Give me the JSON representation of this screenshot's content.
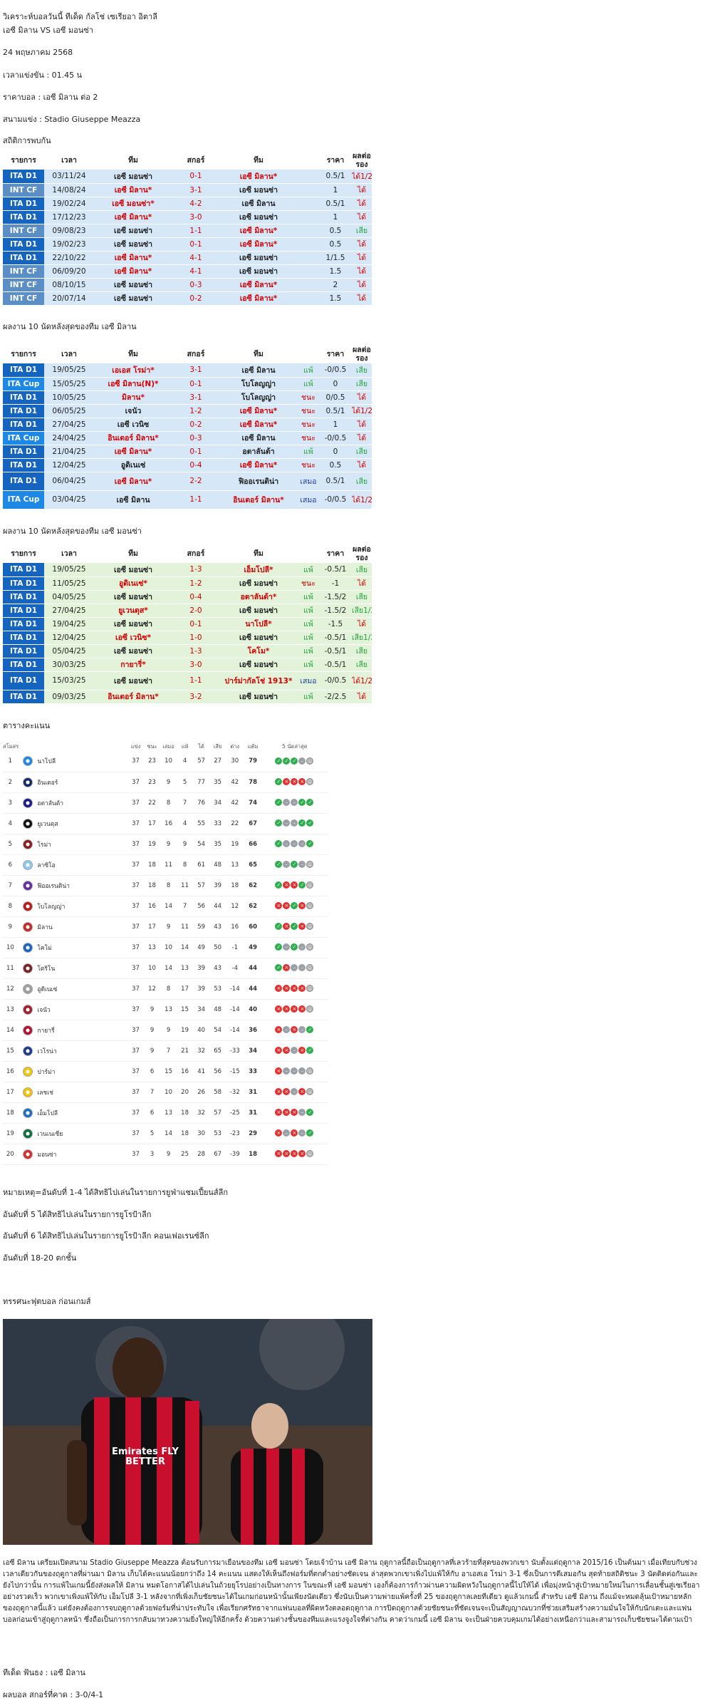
{
  "article": {
    "title": "วิเคราะห์บอลวันนี้ ทีเด็ด กัลโช่ เซเรียอา อิตาลี",
    "match": "เอซี มิลาน VS เอซี มอนซ่า",
    "date": "24 พฤษภาคม 2568",
    "kickoff": "เวลาแข่งขัน : 01.45 น",
    "price": "ราคาบอล : เอซี มิลาน ต่อ 2",
    "venue": "สนามแข่ง : Stadio Giuseppe Meazza",
    "h2h_heading": "สถิติการพบกัน",
    "milan_heading": "ผลงาน 10 นัดหลังสุดของทีม เอซี มิลาน",
    "monza_heading": "ผลงาน 10 นัดหลังสุดของทีม เอซี มอนซ่า",
    "standings_heading": "ตารางคะแนน",
    "notes": [
      "หมายเหตุ=อันดับที่ 1-4 ได้สิทธิไปเล่นในรายการยูฟ่าแชมเปี้ยนส์ลีก",
      "อันดับที่ 5 ได้สิทธิไปเล่นในรายการยูโรป้าลีก",
      "อันดับที่ 6 ได้สิทธิไปเล่นในรายการยูโรป้าลีก คอนเฟอเรนซ์ลีก",
      "อันดับที่ 18-20 ตกชั้น"
    ],
    "analysis_heading": "ทรรศนะฟุตบอล ก่อนเกมส์",
    "photo_alt": "ภาพนักเตะเอซี มิลาน",
    "photo_shirt_text": "Emirates FLY BETTER",
    "paragraph": "เอซี มิลาน เตรียมเปิดสนาม Stadio Giuseppe Meazza ต้อนรับการมาเยือนของทีม เอซี มอนซ่า โดยเจ้าบ้าน เอซี มิลาน ฤดูกาลนี้ถือเป็นฤดูกาลที่เลวร้ายที่สุดของพวกเขา นับตั้งแต่ฤดูกาล 2015/16 เป็นต้นมา เมื่อเทียบกับช่วงเวลาเดียวกันของฤดูกาลที่ผ่านมา มิลาน เก็บได้คะแนนน้อยกว่าถึง 14 คะแนน แสดงให้เห็นถึงฟอร์มที่ตกต่ำอย่างชัดเจน ล่าสุดพวกเขาเพิ่งไปแพ้ให้กับ อาเอสเอ โรม่า 3-1 ซึ่งเป็นการตีเสมอกัน สุดท้ายสถิติชนะ 3 นัดติดต่อกันและยังไปกว่านั้น การแพ้ในเกมนี้ยังส่งผลให้ มิลาน หมดโอกาสได้ไปเล่นในถ้วยยุโรปอย่างเป็นทางการ ในขณะที่ เอซี มอนซ่า เองก็ต้องการก้าวผ่านความผิดหวังในฤดูกาลนี้ไปให้ได้ เพื่อมุ่งหน้าสู่เป้าหมายใหม่ในการเลื่อนชั้นสู่เซเรียอาอย่างรวดเร็ว พวกเขาเพิ่งแพ้ให้กับ เอ็มโปลี 3-1 หลังจากที่เพิ่งเก็บชัยชนะได้ในเกมก่อนหน้านั้นเพียงนัดเดียว ซึ่งนับเป็นความพ่ายแพ้ครั้งที่ 25 ของฤดูกาลเลยทีเดียว ดูแล้วเกมนี้ สำหรับ เอซี มิลาน ถึงแม้จะหมดลุ้นเป้าหมายหลักของฤดูกาลนี้แล้ว แต่ยังคงต้องการจบฤดูกาลด้วยฟอร์มที่น่าประทับใจ เพื่อเรียกศรัทธาจากแฟนบอลที่ผิดหวังตลอดฤดูกาล การปิดฤดูกาลด้วยชัยชนะที่ชัดเจนจะเป็นสัญญาณบวกที่ช่วยเสริมสร้างความมั่นใจให้กับนักเตะและแฟนบอลก่อนเข้าสู่ฤดูกาลหน้า ซึ่งถือเป็นการการกลับมาทวงความยิ่งใหญ่ให้อีกครั้ง ด้วยความต่างชั้นของทีมและแรงจูงใจที่ต่างกัน คาดว่าเกมนี้ เอซี มิลาน จะเป็นฝ่ายควบคุมเกมได้อย่างเหนือกว่าและสามารถเก็บชัยชนะได้ตามเป้า",
    "pick": "ทีเด็ด ฟันธง : เอซี มิลาน",
    "score": "ผลบอล สกอร์ที่คาด : 3-0/4-1"
  },
  "form_headers": [
    "รายการ",
    "เวลา",
    "ทีม",
    "สกอร์",
    "ทีม",
    "",
    "ราคา",
    "ผลต่อรอง"
  ],
  "h2h_rows": [
    {
      "lg": "ITA D1",
      "date": "03/11/24",
      "home": "เอซี มอนซ่า",
      "score": "0-1",
      "away": "เอซี มิลาน*",
      "res": "",
      "price": "0.5/1",
      "ou": "ได้1/2"
    },
    {
      "lg": "INT CF",
      "date": "14/08/24",
      "home": "เอซี มิลาน*",
      "score": "3-1",
      "away": "เอซี มอนซ่า",
      "res": "",
      "price": "1",
      "ou": "ได้"
    },
    {
      "lg": "ITA D1",
      "date": "19/02/24",
      "home": "เอซี มอนซ่า*",
      "score": "4-2",
      "away": "เอซี มิลาน",
      "res": "",
      "price": "0.5/1",
      "ou": "ได้"
    },
    {
      "lg": "ITA D1",
      "date": "17/12/23",
      "home": "เอซี มิลาน*",
      "score": "3-0",
      "away": "เอซี มอนซ่า",
      "res": "",
      "price": "1",
      "ou": "ได้"
    },
    {
      "lg": "INT CF",
      "date": "09/08/23",
      "home": "เอซี มอนซ่า",
      "score": "1-1",
      "away": "เอซี มิลาน*",
      "res": "",
      "price": "0.5",
      "ou": "เสีย"
    },
    {
      "lg": "ITA D1",
      "date": "19/02/23",
      "home": "เอซี มอนซ่า",
      "score": "0-1",
      "away": "เอซี มิลาน*",
      "res": "",
      "price": "0.5",
      "ou": "ได้"
    },
    {
      "lg": "ITA D1",
      "date": "22/10/22",
      "home": "เอซี มิลาน*",
      "score": "4-1",
      "away": "เอซี มอนซ่า",
      "res": "",
      "price": "1/1.5",
      "ou": "ได้"
    },
    {
      "lg": "INT CF",
      "date": "06/09/20",
      "home": "เอซี มิลาน*",
      "score": "4-1",
      "away": "เอซี มอนซ่า",
      "res": "",
      "price": "1.5",
      "ou": "ได้"
    },
    {
      "lg": "INT CF",
      "date": "08/10/15",
      "home": "เอซี มอนซ่า",
      "score": "0-3",
      "away": "เอซี มิลาน*",
      "res": "",
      "price": "2",
      "ou": "ได้"
    },
    {
      "lg": "INT CF",
      "date": "20/07/14",
      "home": "เอซี มอนซ่า",
      "score": "0-2",
      "away": "เอซี มิลาน*",
      "res": "",
      "price": "1.5",
      "ou": "ได้"
    }
  ],
  "milan_rows": [
    {
      "lg": "ITA D1",
      "date": "19/05/25",
      "home": "เอเอส โรม่า*",
      "score": "3-1",
      "away": "เอซี มิลาน",
      "res": "แพ้",
      "price": "-0/0.5",
      "ou": "เสีย"
    },
    {
      "lg": "ITA Cup",
      "date": "15/05/25",
      "home": "เอซี มิลาน(N)*",
      "score": "0-1",
      "away": "โบโลญญ่า",
      "res": "แพ้",
      "price": "0",
      "ou": "เสีย"
    },
    {
      "lg": "ITA D1",
      "date": "10/05/25",
      "home": "มิลาน*",
      "score": "3-1",
      "away": "โบโลญญ่า",
      "res": "ชนะ",
      "price": "0/0.5",
      "ou": "ได้"
    },
    {
      "lg": "ITA D1",
      "date": "06/05/25",
      "home": "เจนัว",
      "score": "1-2",
      "away": "เอซี มิลาน*",
      "res": "ชนะ",
      "price": "0.5/1",
      "ou": "ได้1/2"
    },
    {
      "lg": "ITA D1",
      "date": "27/04/25",
      "home": "เอซี เวนิซ",
      "score": "0-2",
      "away": "เอซี มิลาน*",
      "res": "ชนะ",
      "price": "1",
      "ou": "ได้"
    },
    {
      "lg": "ITA Cup",
      "date": "24/04/25",
      "home": "อินเตอร์ มิลาน*",
      "score": "0-3",
      "away": "เอซี มิลาน",
      "res": "ชนะ",
      "price": "-0/0.5",
      "ou": "ได้"
    },
    {
      "lg": "ITA D1",
      "date": "21/04/25",
      "home": "เอซี มิลาน*",
      "score": "0-1",
      "away": "อตาลันต้า",
      "res": "แพ้",
      "price": "0",
      "ou": "เสีย"
    },
    {
      "lg": "ITA D1",
      "date": "12/04/25",
      "home": "อูดิเนเซ่",
      "score": "0-4",
      "away": "เอซี มิลาน*",
      "res": "ชนะ",
      "price": "0.5",
      "ou": "ได้"
    },
    {
      "lg": "ITA D1",
      "date": "06/04/25",
      "home": "เอซี มิลาน*",
      "score": "2-2",
      "away": "ฟิออเรนติน่า",
      "res": "เสมอ",
      "price": "0.5/1",
      "ou": "เสีย"
    },
    {
      "lg": "ITA Cup",
      "date": "03/04/25",
      "home": "เอซี มิลาน",
      "score": "1-1",
      "away": "อินเตอร์ มิลาน*",
      "res": "เสมอ",
      "price": "-0/0.5",
      "ou": "ได้1/2"
    }
  ],
  "monza_rows": [
    {
      "lg": "ITA D1",
      "date": "19/05/25",
      "home": "เอซี มอนซ่า",
      "score": "1-3",
      "away": "เอ็มโปลี*",
      "res": "แพ้",
      "price": "-0.5/1",
      "ou": "เสีย"
    },
    {
      "lg": "ITA D1",
      "date": "11/05/25",
      "home": "อูดิเนเซ่*",
      "score": "1-2",
      "away": "เอซี มอนซ่า",
      "res": "ชนะ",
      "price": "-1",
      "ou": "ได้"
    },
    {
      "lg": "ITA D1",
      "date": "04/05/25",
      "home": "เอซี มอนซ่า",
      "score": "0-4",
      "away": "อตาลันต้า*",
      "res": "แพ้",
      "price": "-1.5/2",
      "ou": "เสีย"
    },
    {
      "lg": "ITA D1",
      "date": "27/04/25",
      "home": "ยูเวนตุส*",
      "score": "2-0",
      "away": "เอซี มอนซ่า",
      "res": "แพ้",
      "price": "-1.5/2",
      "ou": "เสีย1/2"
    },
    {
      "lg": "ITA D1",
      "date": "19/04/25",
      "home": "เอซี มอนซ่า",
      "score": "0-1",
      "away": "นาโปลี*",
      "res": "แพ้",
      "price": "-1.5",
      "ou": "ได้"
    },
    {
      "lg": "ITA D1",
      "date": "12/04/25",
      "home": "เอซี เวนิซ*",
      "score": "1-0",
      "away": "เอซี มอนซ่า",
      "res": "แพ้",
      "price": "-0.5/1",
      "ou": "เสีย1/2"
    },
    {
      "lg": "ITA D1",
      "date": "05/04/25",
      "home": "เอซี มอนซ่า",
      "score": "1-3",
      "away": "โคโม*",
      "res": "แพ้",
      "price": "-0.5/1",
      "ou": "เสีย"
    },
    {
      "lg": "ITA D1",
      "date": "30/03/25",
      "home": "กายารี่*",
      "score": "3-0",
      "away": "เอซี มอนซ่า",
      "res": "แพ้",
      "price": "-0.5/1",
      "ou": "เสีย"
    },
    {
      "lg": "ITA D1",
      "date": "15/03/25",
      "home": "เอซี มอนซ่า",
      "score": "1-1",
      "away": "ปาร์ม่ากัลโช่ 1913*",
      "res": "เสมอ",
      "price": "-0/0.5",
      "ou": "ได้1/2"
    },
    {
      "lg": "ITA D1",
      "date": "09/03/25",
      "home": "อินเตอร์ มิลาน*",
      "score": "3-2",
      "away": "เอซี มอนซ่า",
      "res": "แพ้",
      "price": "-2/2.5",
      "ou": "ได้"
    }
  ],
  "standings": {
    "headers": [
      "สโมสร",
      "",
      "แข่ง",
      "ชนะ",
      "เสมอ",
      "แพ้",
      "ได้",
      "เสีย",
      "ต่าง",
      "แต้ม",
      "5 นัดล่าสุด"
    ],
    "rows": [
      {
        "pos": "1",
        "team": "นาโปลี",
        "logo": "#1e88e5",
        "p": "37",
        "w": "23",
        "d": "10",
        "l": "4",
        "gf": "57",
        "ga": "27",
        "gd": "30",
        "pts": "79",
        "form": [
          "W",
          "W",
          "W",
          "D",
          "N"
        ]
      },
      {
        "pos": "2",
        "team": "อินเตอร์",
        "logo": "#102a6b",
        "p": "37",
        "w": "23",
        "d": "9",
        "l": "5",
        "gf": "77",
        "ga": "35",
        "gd": "42",
        "pts": "78",
        "form": [
          "W",
          "L",
          "L",
          "L",
          "N"
        ]
      },
      {
        "pos": "3",
        "team": "อตาลันต้า",
        "logo": "#1a1a8a",
        "p": "37",
        "w": "22",
        "d": "8",
        "l": "7",
        "gf": "76",
        "ga": "34",
        "gd": "42",
        "pts": "74",
        "form": [
          "W",
          "D",
          "D",
          "W",
          "W"
        ]
      },
      {
        "pos": "4",
        "team": "ยูเวนตุส",
        "logo": "#111111",
        "p": "37",
        "w": "17",
        "d": "16",
        "l": "4",
        "gf": "55",
        "ga": "33",
        "gd": "22",
        "pts": "67",
        "form": [
          "W",
          "D",
          "D",
          "W",
          "W"
        ]
      },
      {
        "pos": "5",
        "team": "โรม่า",
        "logo": "#8e1b1b",
        "p": "37",
        "w": "19",
        "d": "9",
        "l": "9",
        "gf": "54",
        "ga": "35",
        "gd": "19",
        "pts": "66",
        "form": [
          "W",
          "D",
          "D",
          "D",
          "W"
        ]
      },
      {
        "pos": "6",
        "team": "ลาซิโอ",
        "logo": "#8ac8ef",
        "p": "37",
        "w": "18",
        "d": "11",
        "l": "8",
        "gf": "61",
        "ga": "48",
        "gd": "13",
        "pts": "65",
        "form": [
          "W",
          "D",
          "W",
          "D",
          "N"
        ]
      },
      {
        "pos": "7",
        "team": "ฟิออเรนติน่า",
        "logo": "#6a2b9e",
        "p": "37",
        "w": "18",
        "d": "8",
        "l": "11",
        "gf": "57",
        "ga": "39",
        "gd": "18",
        "pts": "62",
        "form": [
          "W",
          "L",
          "L",
          "W",
          "N"
        ]
      },
      {
        "pos": "8",
        "team": "โบโลญญ่า",
        "logo": "#b71c1c",
        "p": "37",
        "w": "16",
        "d": "14",
        "l": "7",
        "gf": "56",
        "ga": "44",
        "gd": "12",
        "pts": "62",
        "form": [
          "L",
          "L",
          "W",
          "L",
          "N"
        ]
      },
      {
        "pos": "9",
        "team": "มิลาน",
        "logo": "#c62828",
        "p": "37",
        "w": "17",
        "d": "9",
        "l": "11",
        "gf": "59",
        "ga": "43",
        "gd": "16",
        "pts": "60",
        "form": [
          "W",
          "L",
          "W",
          "L",
          "N"
        ]
      },
      {
        "pos": "10",
        "team": "โคโม่",
        "logo": "#1565c0",
        "p": "37",
        "w": "13",
        "d": "10",
        "l": "14",
        "gf": "49",
        "ga": "50",
        "gd": "-1",
        "pts": "49",
        "form": [
          "W",
          "D",
          "W",
          "D",
          "N"
        ]
      },
      {
        "pos": "11",
        "team": "โตริโน",
        "logo": "#7b1f1f",
        "p": "37",
        "w": "10",
        "d": "14",
        "l": "13",
        "gf": "39",
        "ga": "43",
        "gd": "-4",
        "pts": "44",
        "form": [
          "W",
          "L",
          "D",
          "D",
          "N"
        ]
      },
      {
        "pos": "12",
        "team": "อูดิเนเซ่",
        "logo": "#9e9e9e",
        "p": "37",
        "w": "12",
        "d": "8",
        "l": "17",
        "gf": "39",
        "ga": "53",
        "gd": "-14",
        "pts": "44",
        "form": [
          "L",
          "L",
          "L",
          "L",
          "N"
        ]
      },
      {
        "pos": "13",
        "team": "เจนัว",
        "logo": "#a31c2b",
        "p": "37",
        "w": "9",
        "d": "13",
        "l": "15",
        "gf": "34",
        "ga": "48",
        "gd": "-14",
        "pts": "40",
        "form": [
          "L",
          "L",
          "L",
          "L",
          "N"
        ]
      },
      {
        "pos": "14",
        "team": "กายารี่",
        "logo": "#b2102f",
        "p": "37",
        "w": "9",
        "d": "9",
        "l": "19",
        "gf": "40",
        "ga": "54",
        "gd": "-14",
        "pts": "36",
        "form": [
          "L",
          "D",
          "L",
          "D",
          "W"
        ]
      },
      {
        "pos": "15",
        "team": "เวโรน่า",
        "logo": "#1b3a8c",
        "p": "37",
        "w": "9",
        "d": "7",
        "l": "21",
        "gf": "32",
        "ga": "65",
        "gd": "-33",
        "pts": "34",
        "form": [
          "L",
          "L",
          "D",
          "L",
          "W"
        ]
      },
      {
        "pos": "16",
        "team": "ปาร์ม่า",
        "logo": "#f5c400",
        "p": "37",
        "w": "6",
        "d": "15",
        "l": "16",
        "gf": "41",
        "ga": "56",
        "gd": "-15",
        "pts": "33",
        "form": [
          "L",
          "D",
          "D",
          "D",
          "N"
        ]
      },
      {
        "pos": "17",
        "team": "เลชเช่",
        "logo": "#f2c300",
        "p": "37",
        "w": "7",
        "d": "10",
        "l": "20",
        "gf": "26",
        "ga": "58",
        "gd": "-32",
        "pts": "31",
        "form": [
          "L",
          "L",
          "D",
          "L",
          "N"
        ]
      },
      {
        "pos": "18",
        "team": "เอ็มโปลี",
        "logo": "#1e6fc0",
        "p": "37",
        "w": "6",
        "d": "13",
        "l": "18",
        "gf": "32",
        "ga": "57",
        "gd": "-25",
        "pts": "31",
        "form": [
          "L",
          "L",
          "L",
          "D",
          "W"
        ]
      },
      {
        "pos": "19",
        "team": "เวนเนเซีย",
        "logo": "#0d6e3a",
        "p": "37",
        "w": "5",
        "d": "14",
        "l": "18",
        "gf": "30",
        "ga": "53",
        "gd": "-23",
        "pts": "29",
        "form": [
          "L",
          "D",
          "L",
          "D",
          "W"
        ]
      },
      {
        "pos": "20",
        "team": "มอนซ่า",
        "logo": "#d32f2f",
        "p": "37",
        "w": "3",
        "d": "9",
        "l": "25",
        "gf": "28",
        "ga": "67",
        "gd": "-39",
        "pts": "18",
        "form": [
          "L",
          "L",
          "L",
          "L",
          "N"
        ]
      }
    ]
  },
  "colors": {
    "ita_d1": "#1565c0",
    "int_cf": "#5c8ec6",
    "ita_cup": "#1e88e5",
    "win": "#2eae4e",
    "loss": "#e03131",
    "draw": "#9aa0a6",
    "red_text": "#d50000"
  }
}
